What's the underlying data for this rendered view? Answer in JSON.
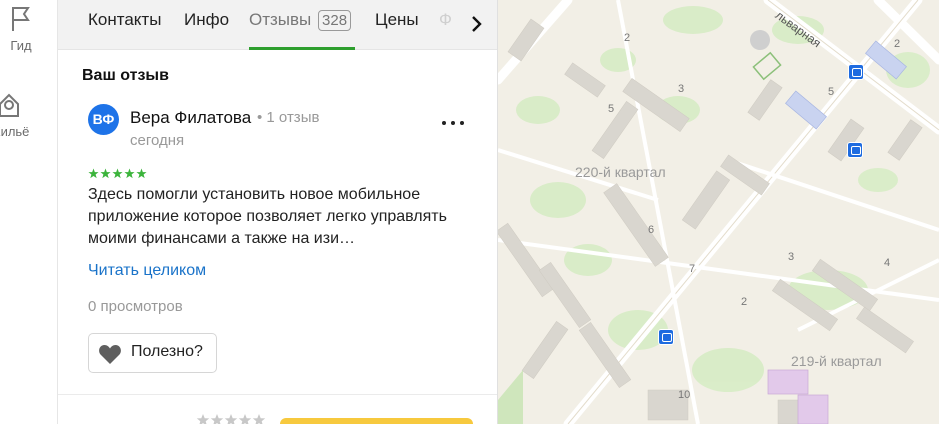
{
  "rail": {
    "gid_label": "Гид",
    "housing_label": "Жильё"
  },
  "tabs": {
    "contacts": "Контакты",
    "info": "Инфо",
    "reviews": "Отзывы",
    "reviews_count": "328",
    "prices": "Цены",
    "faded": "Ф"
  },
  "review": {
    "section_title": "Ваш отзыв",
    "avatar_initials": "ВФ",
    "author": "Вера Филатова",
    "author_reviews": "• 1 отзыв",
    "date": "сегодня",
    "rating": 5,
    "text": "Здесь помогли установить новое мобильное приложение которое позволяет легко управлять моими финансами а также на изи…",
    "read_more": "Читать целиком",
    "views": "0 просмотров",
    "useful_label": "Полезно?"
  },
  "map": {
    "quarter_220": "220-й квартал",
    "quarter_219": "219-й квартал",
    "street": "льварная",
    "house_numbers": [
      "2",
      "5",
      "3",
      "6",
      "7",
      "3",
      "4",
      "2",
      "10",
      "5",
      "2"
    ]
  },
  "colors": {
    "accent_green": "#2e9f2e",
    "link_blue": "#1a73c9",
    "avatar_blue": "#1e73e8",
    "star_green": "#3cb43c",
    "rate_button": "#f7c93e"
  }
}
